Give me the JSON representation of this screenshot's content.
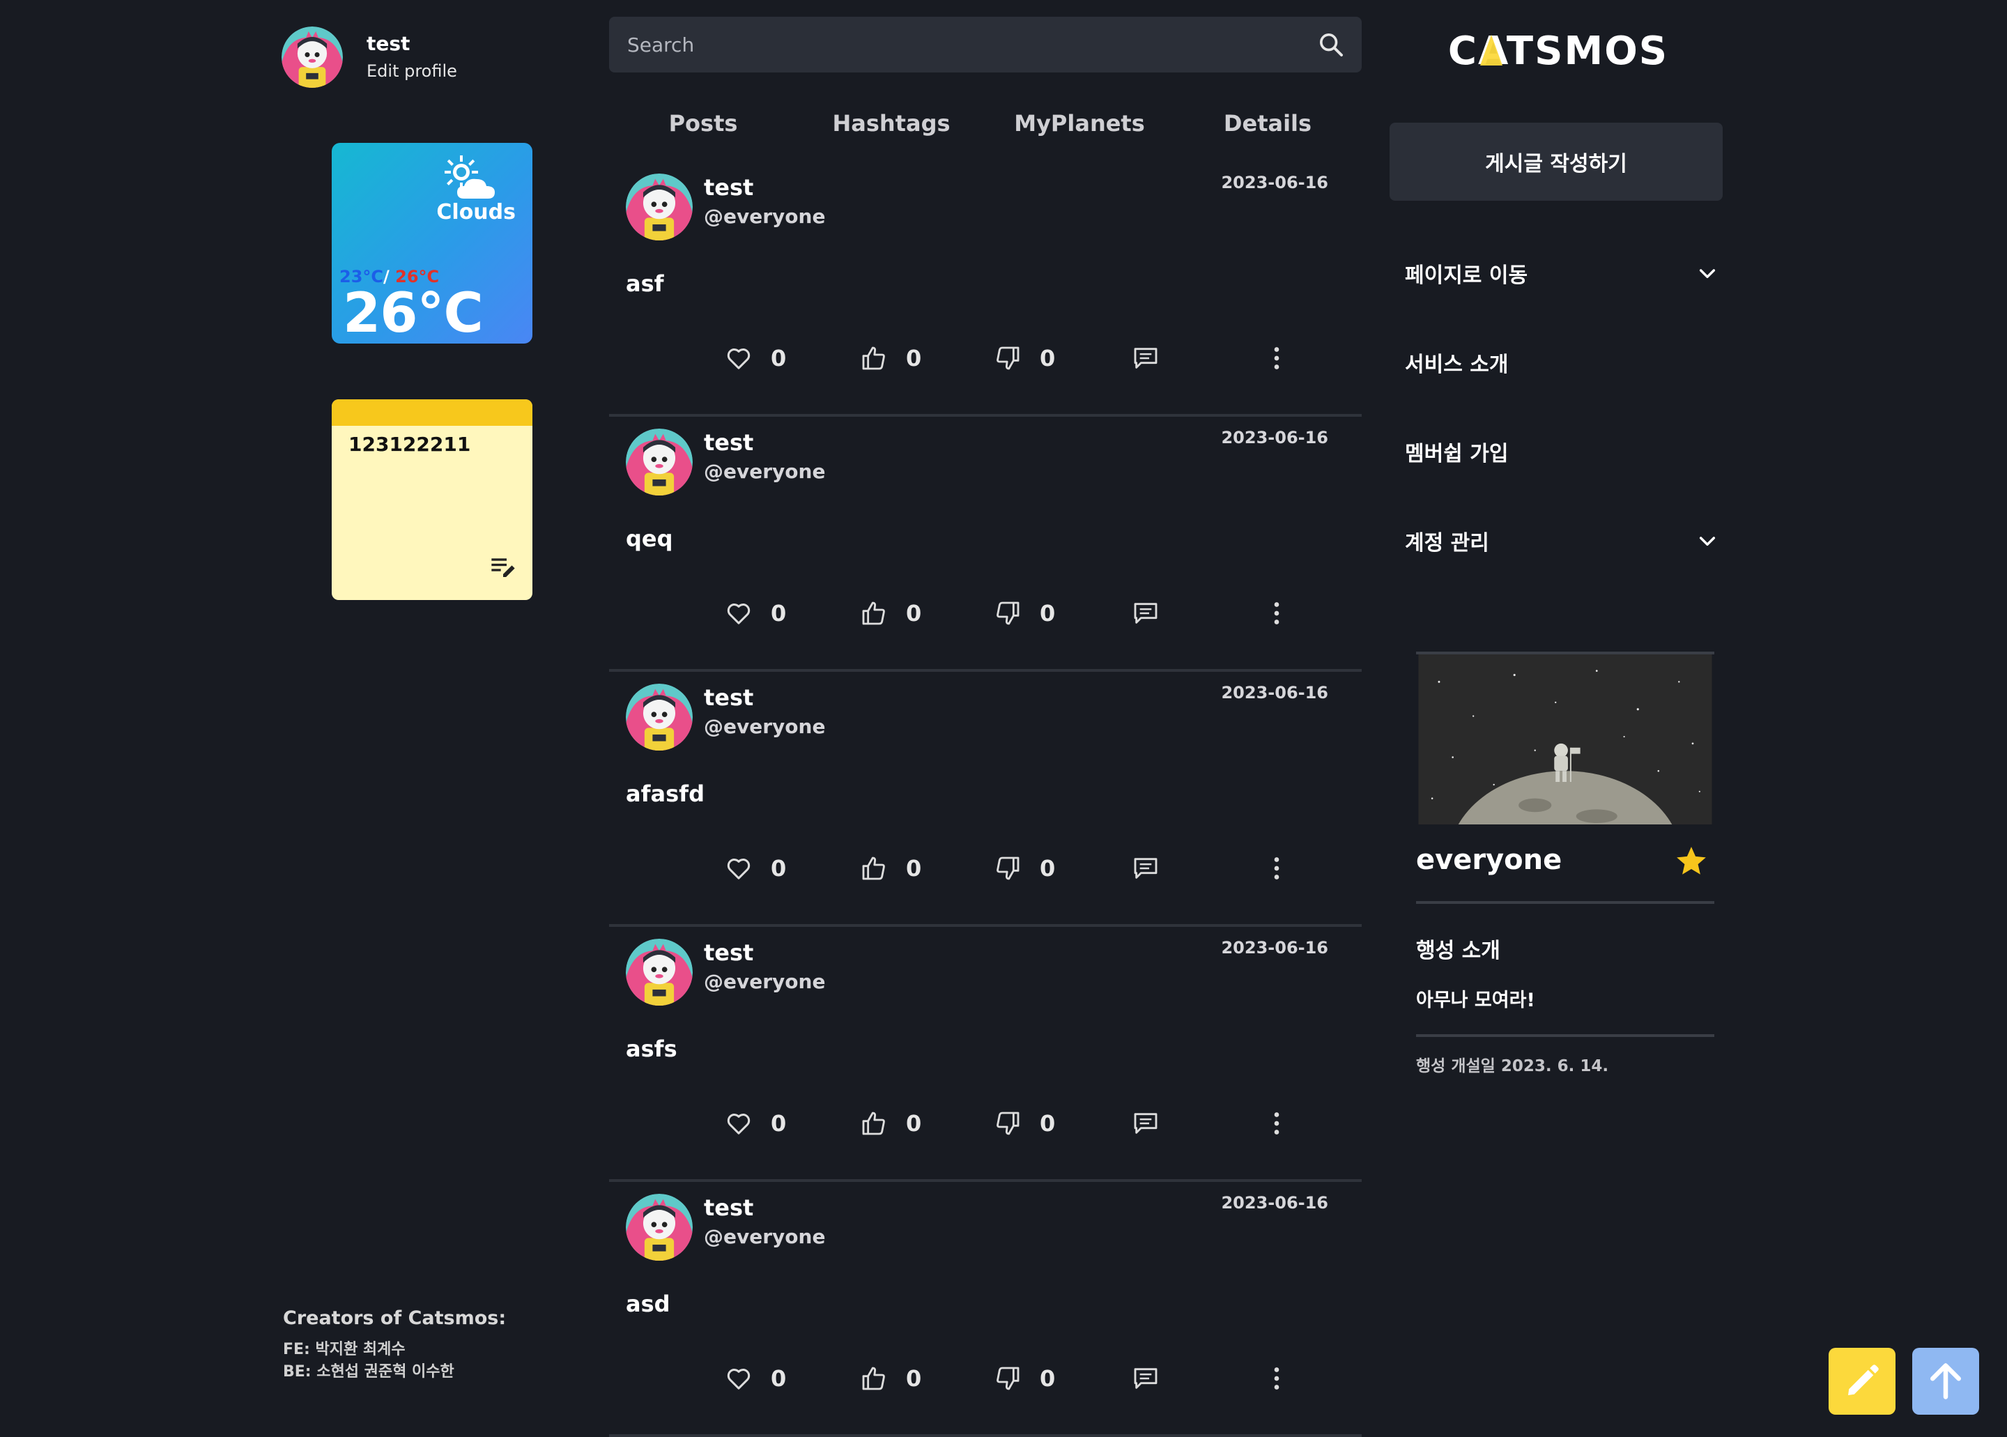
{
  "profile": {
    "name": "test",
    "edit_label": "Edit profile"
  },
  "weather": {
    "description": "Clouds",
    "min": "23°C",
    "separator": "/",
    "max": "26°C",
    "temp": "26°C"
  },
  "memo": {
    "text": "123122211"
  },
  "credits": {
    "title": "Creators of Catsmos:",
    "fe": "FE: 박지환 최계수",
    "be": "BE: 소현섭 권준혁 이수한"
  },
  "search": {
    "placeholder": "Search"
  },
  "tabs": [
    {
      "label": "Posts"
    },
    {
      "label": "Hashtags"
    },
    {
      "label": "MyPlanets"
    },
    {
      "label": "Details"
    }
  ],
  "posts": [
    {
      "author": "test",
      "planet": "@everyone",
      "date": "2023-06-16",
      "body": "asf",
      "likes": "0",
      "ups": "0",
      "downs": "0"
    },
    {
      "author": "test",
      "planet": "@everyone",
      "date": "2023-06-16",
      "body": "qeq",
      "likes": "0",
      "ups": "0",
      "downs": "0"
    },
    {
      "author": "test",
      "planet": "@everyone",
      "date": "2023-06-16",
      "body": "afasfd",
      "likes": "0",
      "ups": "0",
      "downs": "0"
    },
    {
      "author": "test",
      "planet": "@everyone",
      "date": "2023-06-16",
      "body": "asfs",
      "likes": "0",
      "ups": "0",
      "downs": "0"
    },
    {
      "author": "test",
      "planet": "@everyone",
      "date": "2023-06-16",
      "body": "asd",
      "likes": "0",
      "ups": "0",
      "downs": "0"
    }
  ],
  "logo": {
    "text": "CATSMOS"
  },
  "write_button": {
    "label": "게시글 작성하기"
  },
  "menu": [
    {
      "label": "페이지로 이동",
      "icon": "chevron-down-icon"
    },
    {
      "label": "서비스 소개"
    },
    {
      "label": "멤버쉽 가입"
    },
    {
      "label": "계정 관리",
      "icon": "chevron-down-icon"
    }
  ],
  "planet": {
    "name": "everyone",
    "about_title": "행성 소개",
    "about_text": "아무나 모여라!",
    "created": "행성 개설일 2023. 6. 14."
  },
  "colors": {
    "background": "#181b22",
    "panel": "#2b2f38",
    "accent_yellow": "#fcd93c",
    "accent_blue": "#8fb8f2"
  }
}
